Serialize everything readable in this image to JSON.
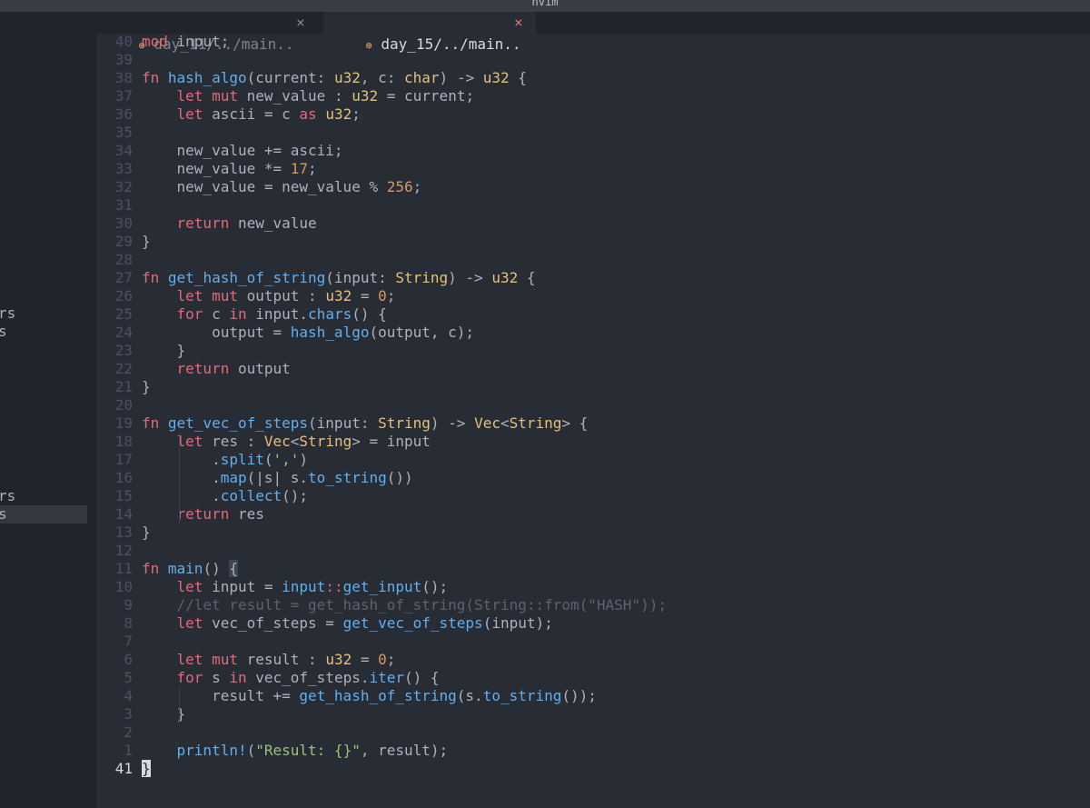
{
  "window": {
    "title": "nvim"
  },
  "sidebar": {
    "rows": [
      {
        "text": "rs",
        "top": 0
      },
      {
        "text": "s",
        "top": 0
      },
      {
        "text": "rs",
        "top": 0
      },
      {
        "text": "s",
        "top": 0,
        "selected": true
      }
    ]
  },
  "tabs": [
    {
      "icon": "⊛",
      "label": "day_11/../main..",
      "close": "×",
      "active": false
    },
    {
      "icon": "⊛",
      "label": "day_15/../main..",
      "close": "×",
      "active": true
    }
  ],
  "editor": {
    "current_line_number": "41",
    "lines": [
      {
        "ln": "40",
        "code": "mod input;"
      },
      {
        "ln": "39",
        "code": ""
      },
      {
        "ln": "38",
        "code": "fn hash_algo(current: u32, c: char) -> u32 {"
      },
      {
        "ln": "37",
        "code": "    let mut new_value : u32 = current;"
      },
      {
        "ln": "36",
        "code": "    let ascii = c as u32;"
      },
      {
        "ln": "35",
        "code": ""
      },
      {
        "ln": "34",
        "code": "    new_value += ascii;"
      },
      {
        "ln": "33",
        "code": "    new_value *= 17;"
      },
      {
        "ln": "32",
        "code": "    new_value = new_value % 256;"
      },
      {
        "ln": "31",
        "code": ""
      },
      {
        "ln": "30",
        "code": "    return new_value"
      },
      {
        "ln": "29",
        "code": "}"
      },
      {
        "ln": "28",
        "code": ""
      },
      {
        "ln": "27",
        "code": "fn get_hash_of_string(input: String) -> u32 {"
      },
      {
        "ln": "26",
        "code": "    let mut output : u32 = 0;"
      },
      {
        "ln": "25",
        "code": "    for c in input.chars() {"
      },
      {
        "ln": "24",
        "code": "        output = hash_algo(output, c);"
      },
      {
        "ln": "23",
        "code": "    }"
      },
      {
        "ln": "22",
        "code": "    return output"
      },
      {
        "ln": "21",
        "code": "}"
      },
      {
        "ln": "20",
        "code": ""
      },
      {
        "ln": "19",
        "code": "fn get_vec_of_steps(input: String) -> Vec<String> {"
      },
      {
        "ln": "18",
        "code": "    let res : Vec<String> = input"
      },
      {
        "ln": "17",
        "code": "        .split(',')"
      },
      {
        "ln": "16",
        "code": "        .map(|s| s.to_string())"
      },
      {
        "ln": "15",
        "code": "        .collect();"
      },
      {
        "ln": "14",
        "code": "    return res"
      },
      {
        "ln": "13",
        "code": "}"
      },
      {
        "ln": "12",
        "code": ""
      },
      {
        "ln": "11",
        "code": "fn main() {"
      },
      {
        "ln": "10",
        "code": "    let input = input::get_input();"
      },
      {
        "ln": "9",
        "code": "    //let result = get_hash_of_string(String::from(\"HASH\"));"
      },
      {
        "ln": "8",
        "code": "    let vec_of_steps = get_vec_of_steps(input);"
      },
      {
        "ln": "7",
        "code": ""
      },
      {
        "ln": "6",
        "code": "    let mut result : u32 = 0;"
      },
      {
        "ln": "5",
        "code": "    for s in vec_of_steps.iter() {"
      },
      {
        "ln": "4",
        "code": "        result += get_hash_of_string(s.to_string());"
      },
      {
        "ln": "3",
        "code": "    }"
      },
      {
        "ln": "2",
        "code": ""
      },
      {
        "ln": "1",
        "code": "    println!(\"Result: {}\", result);"
      },
      {
        "ln": "41",
        "code": "}"
      }
    ]
  },
  "colors": {
    "background": "#282c34",
    "keyword": "#e06c75",
    "function": "#61afef",
    "type": "#e5c07b",
    "number": "#d19a66",
    "string": "#98c379",
    "comment": "#5c6370"
  }
}
